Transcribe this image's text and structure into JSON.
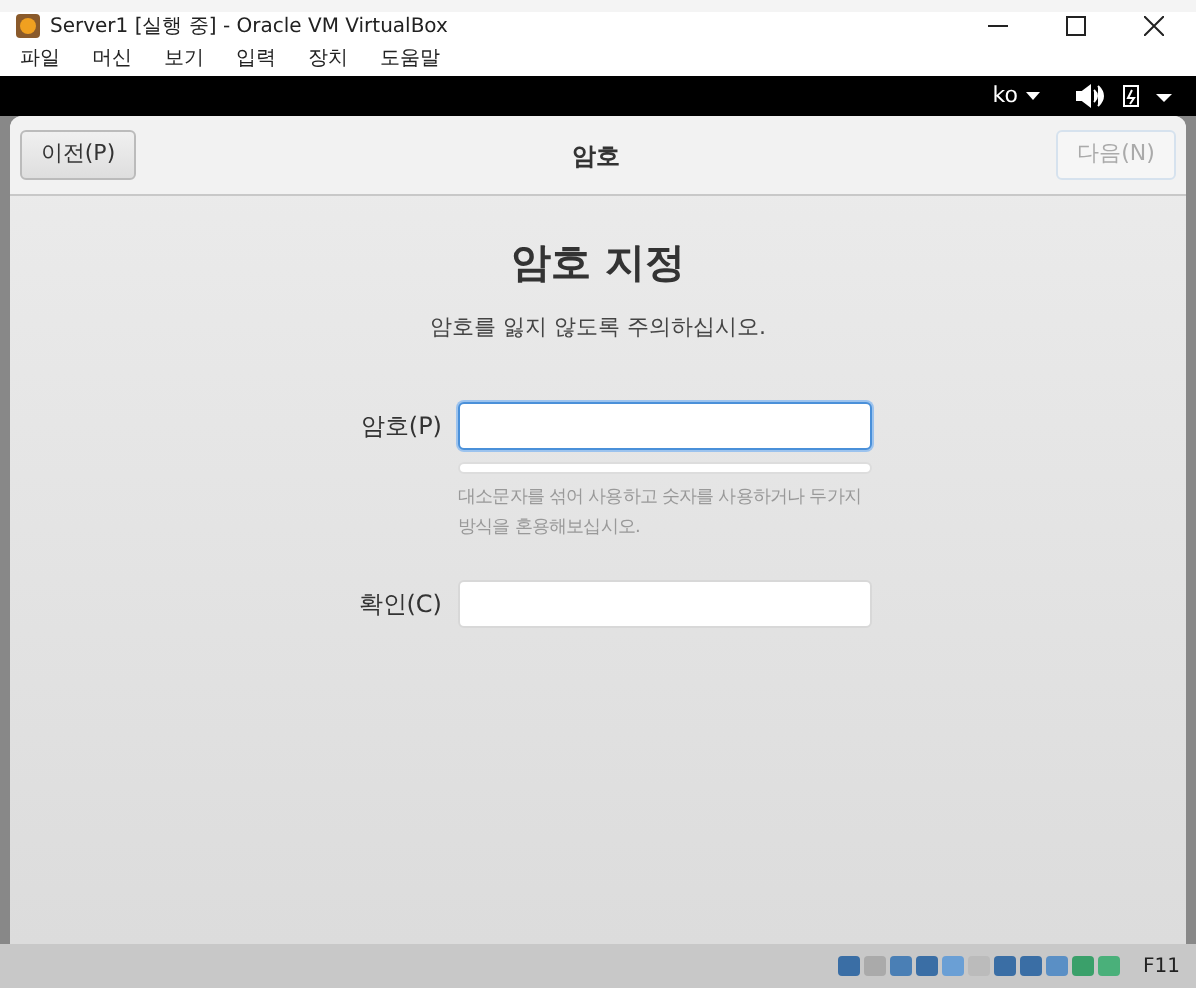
{
  "window": {
    "title": "Server1 [실행 중] - Oracle VM VirtualBox"
  },
  "menu": [
    "파일",
    "머신",
    "보기",
    "입력",
    "장치",
    "도움말"
  ],
  "top_bar": {
    "language": "ko"
  },
  "header": {
    "back": {
      "label": "이전(P)",
      "disabled": false
    },
    "title": "암호",
    "next": {
      "label": "다음(N)",
      "disabled": true
    }
  },
  "page": {
    "title": "암호 지정",
    "subtitle": "암호를 잃지 않도록 주의하십시오.",
    "fields": [
      {
        "label": "암호(P)",
        "focused": true
      },
      {
        "label": "확인(C)",
        "focused": false
      }
    ],
    "hint": "대소문자를 섞어 사용하고 숫자를 사용하거나 두가지 방식을 혼용해보십시오."
  },
  "status_bar": {
    "host_key": "F11"
  }
}
